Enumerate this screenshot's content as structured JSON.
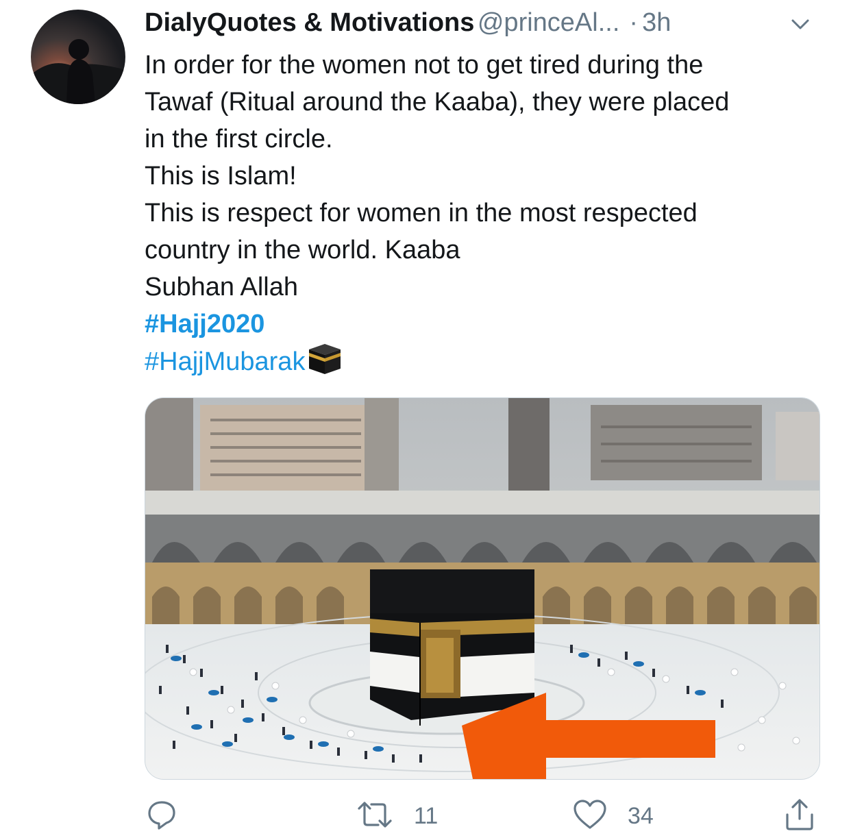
{
  "tweet": {
    "author_name": "DialyQuotes & Motivations",
    "author_handle": "@princeAl...",
    "separator": "·",
    "time": "3h",
    "lines": [
      "In order for the women not to get tired during the",
      "Tawaf (Ritual around the Kaaba), they were placed",
      "in the first circle.",
      "This is Islam!",
      "This is respect for women in the most respected",
      "country in the world. Kaaba",
      "Subhan Allah"
    ],
    "hashtags": [
      "#Hajj2020",
      "#HajjMubarak"
    ],
    "emoji": "kaaba-icon"
  },
  "actions": {
    "reply_count": "",
    "retweet_count": "11",
    "like_count": "34",
    "share_count": ""
  },
  "icons": [
    "caret-down-icon",
    "reply-icon",
    "retweet-icon",
    "like-icon",
    "share-icon"
  ],
  "colors": {
    "link": "#1b95e0",
    "secondary_text": "#657786",
    "arrow": "#f15a0a"
  }
}
